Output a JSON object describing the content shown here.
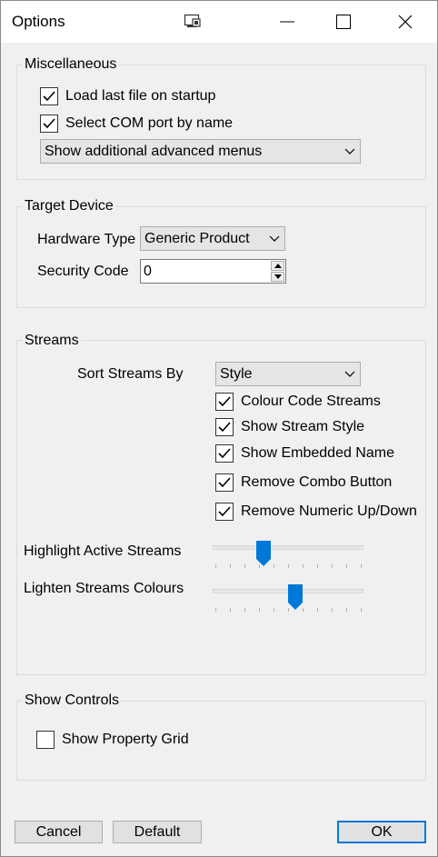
{
  "window": {
    "title": "Options"
  },
  "icons": {
    "app": "window-settings-icon",
    "minimize": "minimize-icon",
    "maximize": "maximize-icon",
    "close": "close-icon",
    "check": "checkmark-icon",
    "dropdown": "chevron-down-icon"
  },
  "colors": {
    "accent": "#0078d7",
    "background": "#f0f0f0"
  },
  "misc": {
    "title": "Miscellaneous",
    "load_last_file": {
      "label": "Load last file on startup",
      "checked": true
    },
    "select_com_port": {
      "label": "Select COM port by name",
      "checked": true
    },
    "advanced_menus": {
      "value": "Show additional advanced menus"
    }
  },
  "target": {
    "title": "Target Device",
    "hardware_type_label": "Hardware Type",
    "hardware_type_value": "Generic Product",
    "security_code_label": "Security Code",
    "security_code_value": "0"
  },
  "streams": {
    "title": "Streams",
    "sort_label": "Sort Streams By",
    "sort_value": "Style",
    "colour_code": {
      "label": "Colour Code Streams",
      "checked": true
    },
    "show_style": {
      "label": "Show Stream Style",
      "checked": true
    },
    "show_embedded": {
      "label": "Show Embedded Name",
      "checked": true
    },
    "remove_combo": {
      "label": "Remove Combo Button",
      "checked": true
    },
    "remove_numeric": {
      "label": "Remove Numeric Up/Down",
      "checked": true
    },
    "highlight": {
      "label": "Highlight Active Streams",
      "value": 0.33
    },
    "lighten": {
      "label": "Lighten Streams Colours",
      "value": 0.55
    }
  },
  "controls": {
    "title": "Show Controls",
    "property_grid": {
      "label": "Show Property Grid",
      "checked": false
    }
  },
  "buttons": {
    "cancel": "Cancel",
    "default": "Default",
    "ok": "OK"
  }
}
